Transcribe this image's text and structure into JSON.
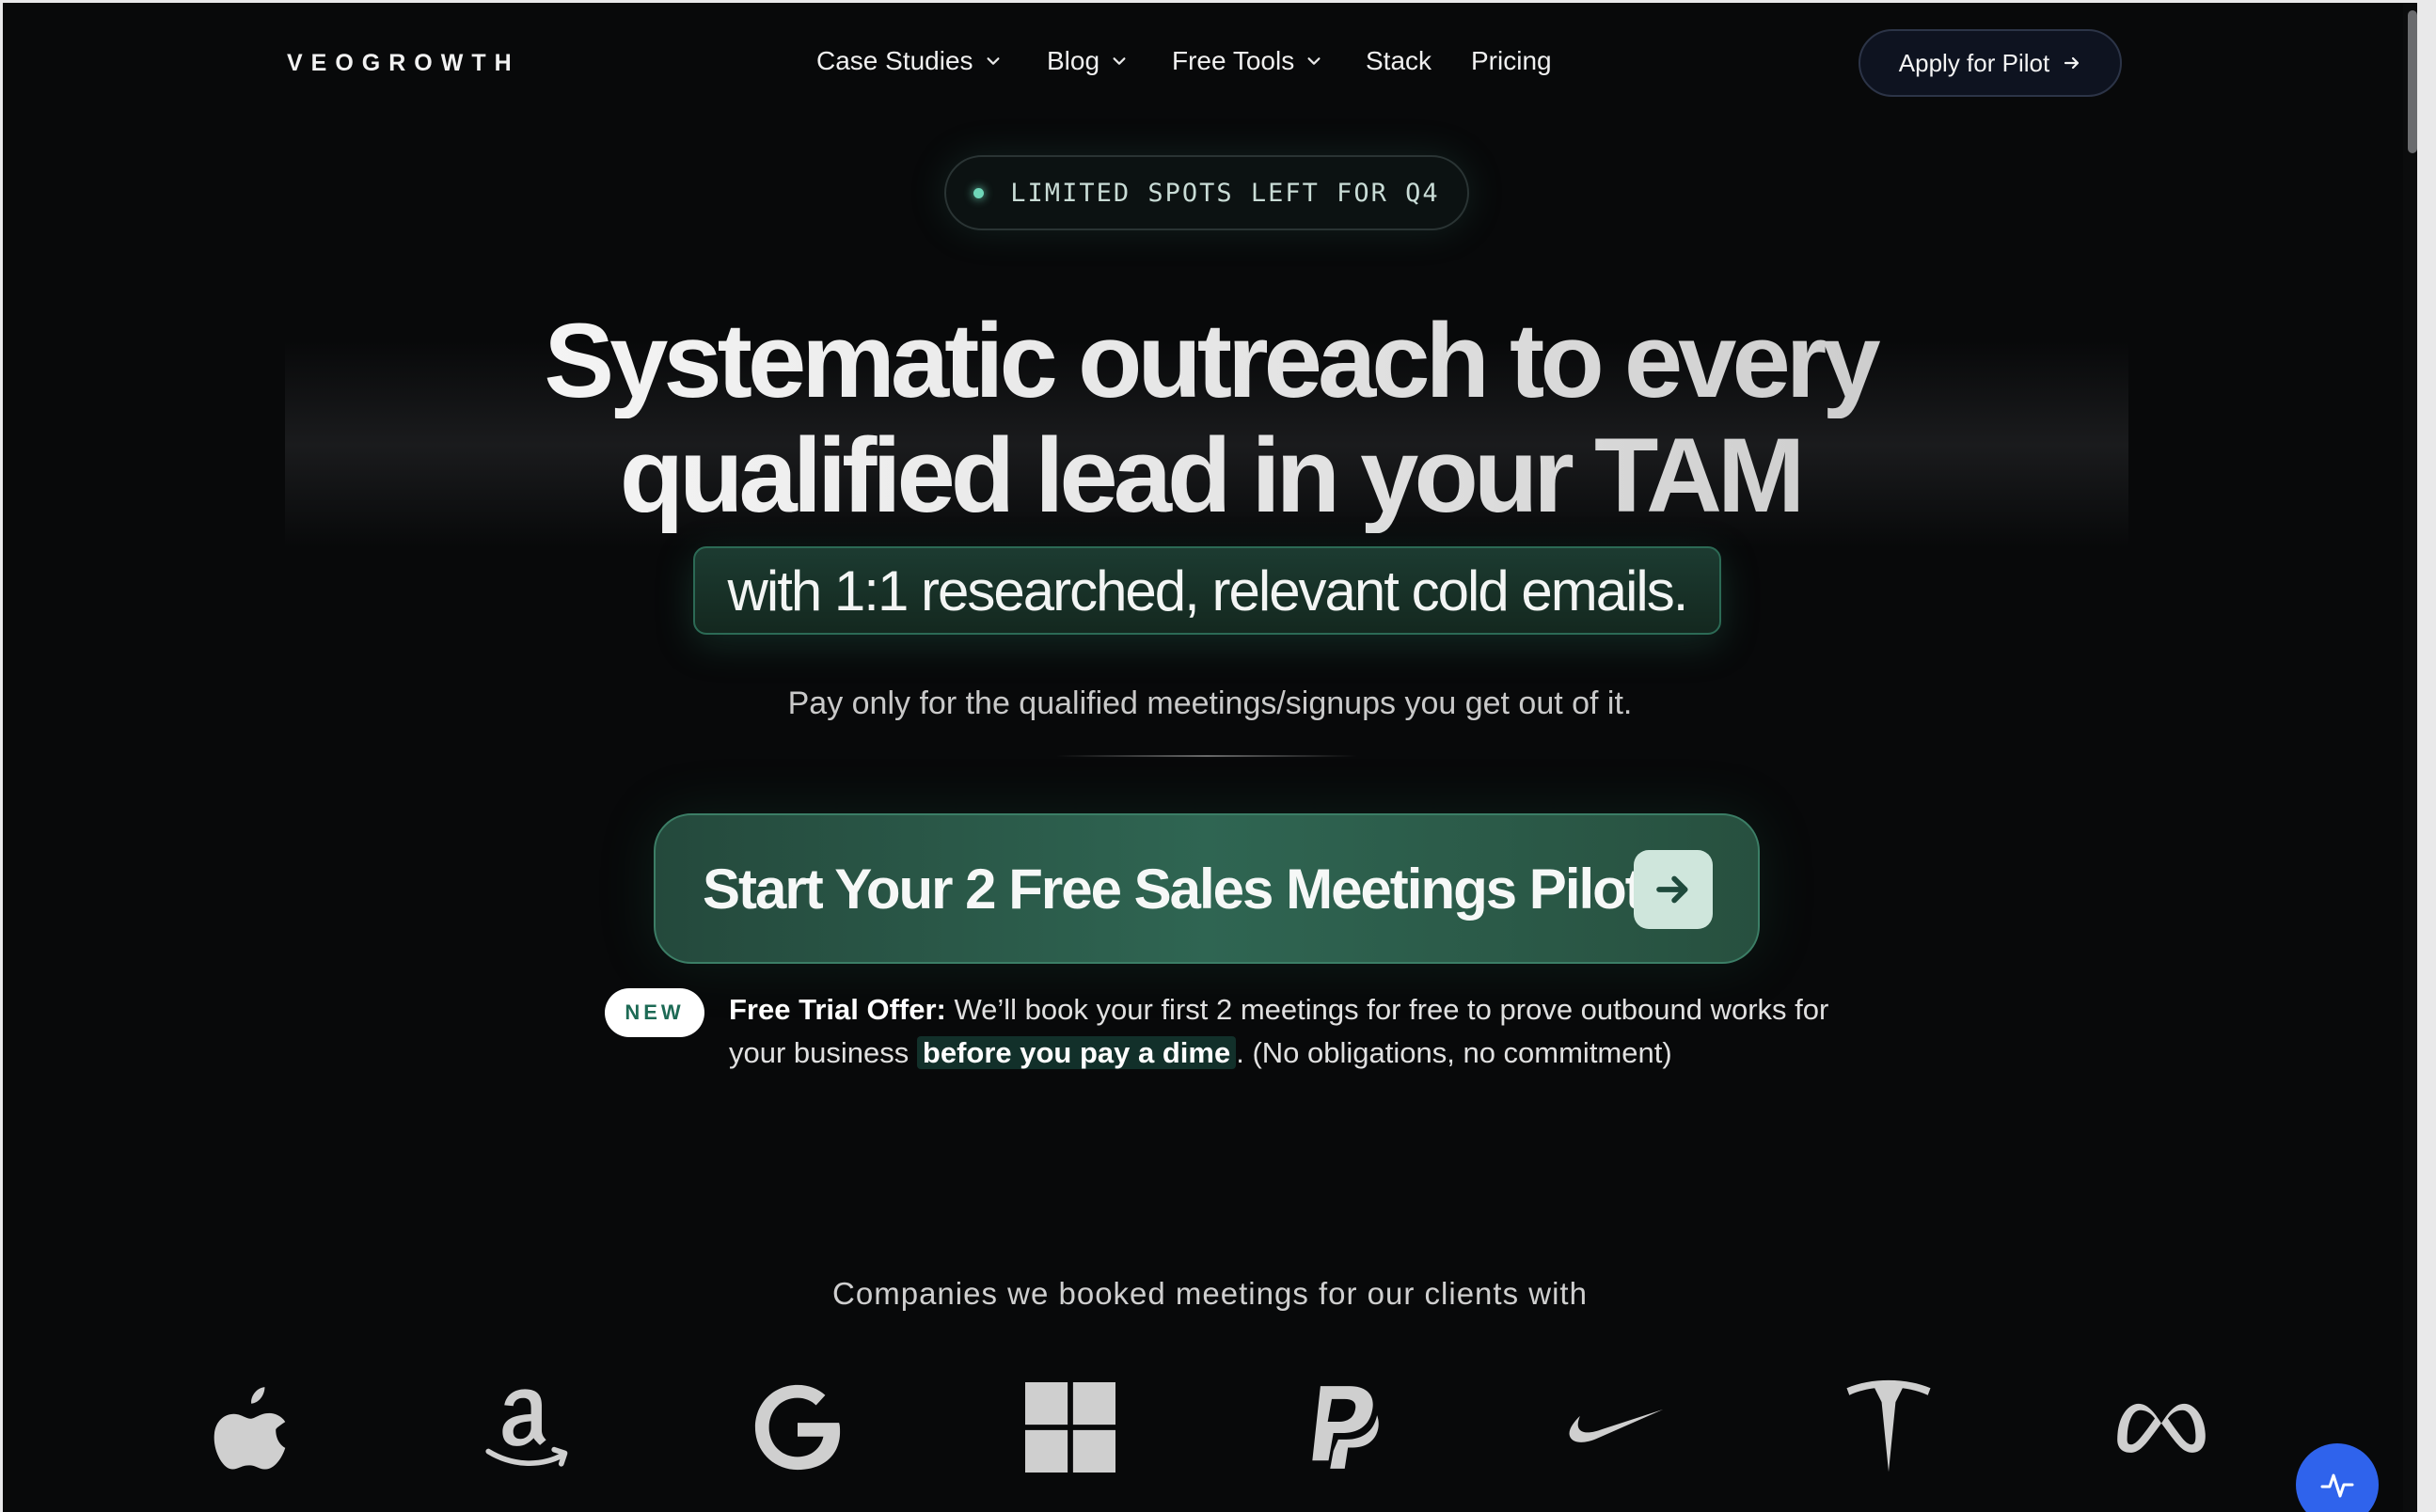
{
  "brand": {
    "logo_text": "VEOGROWTH"
  },
  "nav": {
    "items": [
      {
        "label": "Case Studies",
        "has_dropdown": true
      },
      {
        "label": "Blog",
        "has_dropdown": true
      },
      {
        "label": "Free Tools",
        "has_dropdown": true
      },
      {
        "label": "Stack",
        "has_dropdown": false
      },
      {
        "label": "Pricing",
        "has_dropdown": false
      }
    ],
    "cta_label": "Apply for Pilot"
  },
  "hero": {
    "badge_text": "LIMITED SPOTS LEFT FOR Q4",
    "headline_line1": "Systematic outreach to every",
    "headline_line2": "qualified lead in your TAM",
    "subheadline": "with 1:1 researched, relevant cold emails.",
    "pay_text": "Pay only for the qualified meetings/signups you get out of it.",
    "cta_label": "Start Your 2 Free Sales Meetings Pilot",
    "new_badge": "NEW",
    "offer": {
      "lead": "Free Trial Offer:",
      "text1": " We’ll book your first 2 meetings for free to prove outbound works for your business ",
      "highlight": "before you pay a dime",
      "text2": ". (No obligations, no commitment)"
    }
  },
  "companies": {
    "heading": "Companies we booked meetings for our clients with",
    "logos": [
      "apple-logo",
      "amazon-logo",
      "google-logo",
      "windows-logo",
      "paypal-logo",
      "nike-logo",
      "tesla-logo",
      "meta-logo"
    ]
  },
  "colors": {
    "background": "#08090a",
    "accent_green": "#2f6552",
    "help_button": "#2f63ec"
  }
}
